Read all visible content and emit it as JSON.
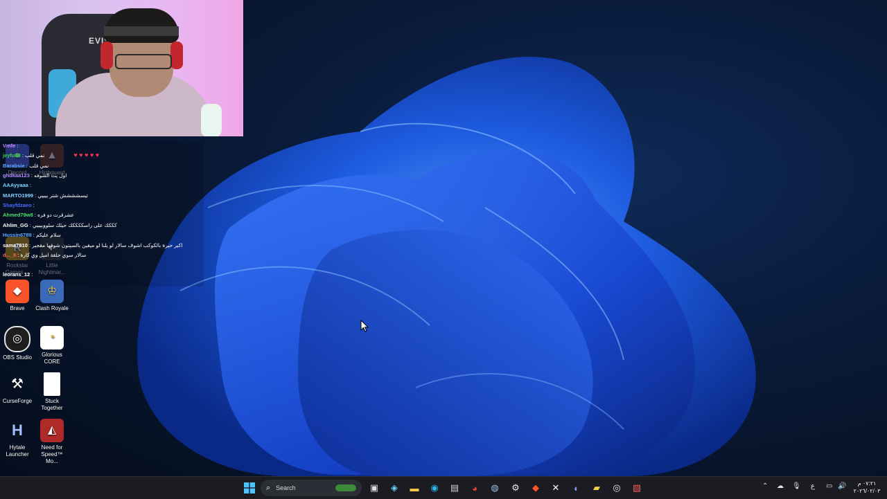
{
  "webcam": {
    "chair_brand": "EVIS"
  },
  "chat": {
    "messages": [
      {
        "user": "Vmfe",
        "sep": " : ",
        "text": "",
        "color": "#c78bff"
      },
      {
        "user": "jeyfu88",
        "sep": " : ",
        "text": "نمي قلب",
        "color": "#31d44b"
      },
      {
        "user": "Barabsie",
        "sep": " : ",
        "text": "نمي قلب",
        "color": "#5aa8ff"
      },
      {
        "user": "ghdkaa123",
        "sep": " : ",
        "text": "اول يت الشوفه",
        "color": "#b18cff"
      },
      {
        "user": "AAAyyaaa",
        "sep": " : ",
        "text": "",
        "color": "#7bd6ff"
      },
      {
        "user": "MARTO1999",
        "sep": " : ",
        "text": "تيسشششش شتر بيبيي",
        "color": "#8ad0ff"
      },
      {
        "user": "Shayfdzaeo",
        "sep": " : ",
        "text": "",
        "color": "#4b6cff"
      },
      {
        "user": "Ahmed79w8",
        "sep": " : ",
        "text": "عشرقرت دو فره",
        "color": "#4ee06c"
      },
      {
        "user": "Ahlim_GG",
        "sep": " : ",
        "text": "كككك على راسككككك حيلك سلووبيبيي",
        "color": "#ffffff"
      },
      {
        "user": "Hussin6789",
        "sep": " : ",
        "text": "سلام عليكم",
        "color": "#5aa8ff"
      },
      {
        "user": "sama7810",
        "sep": " : ",
        "text": "اكبر حيرة بالكوكب اشوف سالار لو يلنا لو ميقين بالسيتون شوفها مقجير",
        "color": "#ffffff"
      },
      {
        "user": "d..._8",
        "sep": " : ",
        "text": "سالار سوي حلقة اميل وي كارة",
        "color": "#ff5a5a"
      },
      {
        "user": "leorans_12",
        "sep": " : ",
        "text": "",
        "color": "#ffffff"
      }
    ],
    "hearts": "♥ ♥ ♥ ♥ ♥"
  },
  "desktop": {
    "faded_icons": [
      {
        "label": "Discord"
      },
      {
        "label": "Highguard"
      },
      {
        "label": "Rockstar Games ..."
      },
      {
        "label": "Little Nightmar..."
      }
    ],
    "icons": [
      {
        "label": "Brave"
      },
      {
        "label": "Clash Royale"
      },
      {
        "label": "OBS Studio"
      },
      {
        "label": "Glorious CORE"
      },
      {
        "label": "CurseForge"
      },
      {
        "label": "Stuck Together"
      },
      {
        "label": "Hytale Launcher"
      },
      {
        "label": "Need for Speed™ Mo..."
      }
    ]
  },
  "taskbar": {
    "search_label": "Search",
    "apps": [
      "windows-start-icon",
      "task-view-icon",
      "copilot-icon",
      "file-explorer-icon",
      "edge-icon",
      "store-icon",
      "chrome-icon",
      "steam-icon",
      "settings-icon",
      "brave-icon",
      "capcut-icon",
      "discord-icon",
      "notes-icon",
      "obs-icon",
      "snip-icon"
    ],
    "tray": {
      "lang": "ع",
      "time": "٠٧:٢١ م",
      "date": "٢٠٢٦/٠٢/٠٣"
    }
  }
}
